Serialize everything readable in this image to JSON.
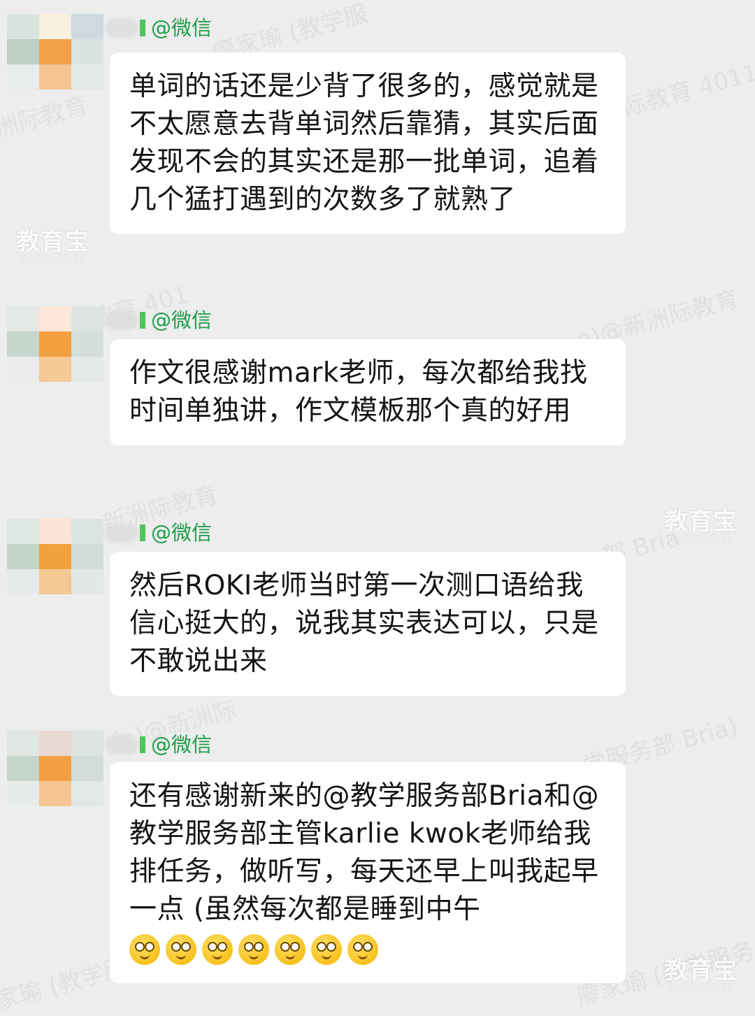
{
  "app": {
    "name": "微信",
    "tag": "@微信"
  },
  "watermarks": [
    "廖家瑜 (教学服",
    "洲际教育",
    "新洲际教育 4011",
    "洲际教育 401",
    "n)@新洲际教育",
    "@新洲际教育",
    "部 Bria",
    "ia)@新洲际",
    "学服务部 Bria)",
    "廖家瑜 (教学服务",
    "家瑜 (教学服"
  ],
  "logo": {
    "main": "教育宝",
    "sub": "JIAOYUBAO.CN"
  },
  "messages": [
    {
      "sender": "@微信",
      "text": "单词的话还是少背了很多的，感觉就是不太愿意去背单词然后靠猜，其实后面发现不会的其实还是那一批单词，追着几个猛打遇到的次数多了就熟了",
      "emoji": []
    },
    {
      "sender": "@微信",
      "text": "作文很感谢mark老师，每次都给我找时间单独讲，作文模板那个真的好用",
      "emoji": []
    },
    {
      "sender": "@微信",
      "text": "然后ROKI老师当时第一次测口语给我信心挺大的，说我其实表达可以，只是不敢说出来",
      "emoji": []
    },
    {
      "sender": "@微信",
      "text": "还有感谢新来的@教学服务部Bria和@教学服务部主管karlie kwok老师给我排任务，做听写，每天还早上叫我起早一点 (虽然每次都是睡到中午",
      "emoji": [
        "dizzy-face",
        "dizzy-face",
        "dizzy-face",
        "dizzy-face",
        "dizzy-face",
        "dizzy-face",
        "dizzy-face"
      ]
    }
  ],
  "colors": {
    "background": "#ededed",
    "bubble": "#ffffff",
    "name_green": "#1f9e4a",
    "accent_bar": "#4fc35f"
  }
}
